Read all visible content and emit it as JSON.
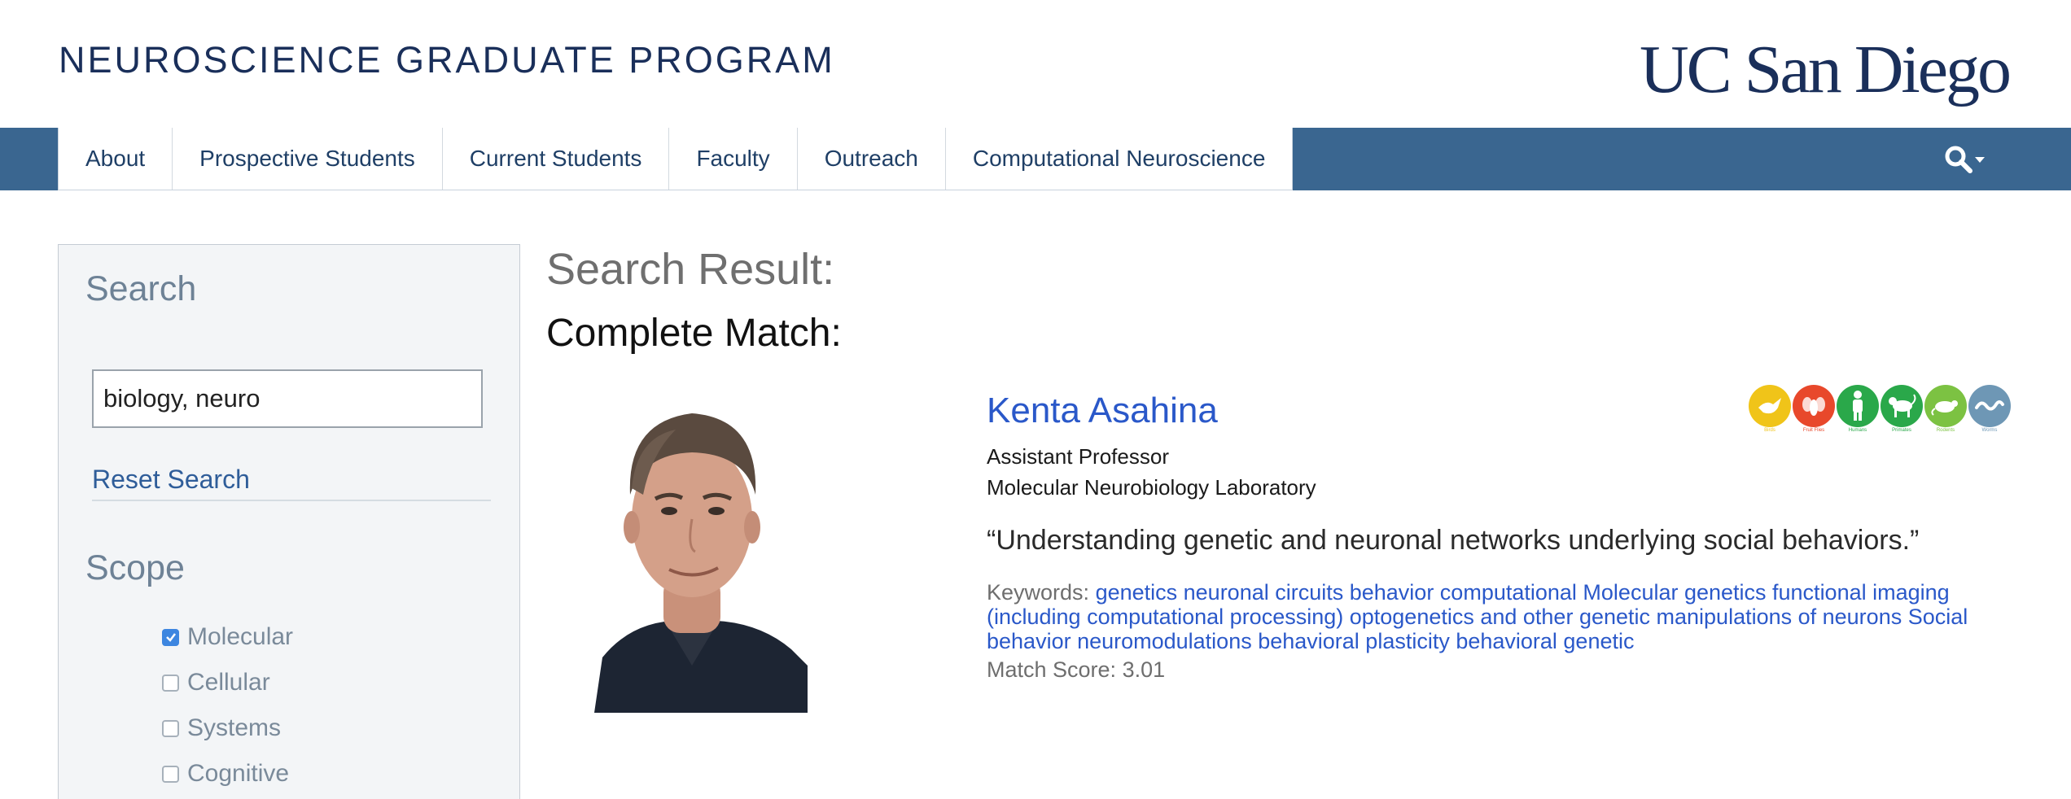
{
  "header": {
    "site_title": "NEUROSCIENCE GRADUATE PROGRAM",
    "logo_text": "UC San Diego"
  },
  "nav": {
    "items": [
      {
        "label": "About"
      },
      {
        "label": "Prospective Students"
      },
      {
        "label": "Current Students"
      },
      {
        "label": "Faculty"
      },
      {
        "label": "Outreach"
      },
      {
        "label": "Computational Neuroscience"
      }
    ],
    "search_icon": "search-icon"
  },
  "sidebar": {
    "search_heading": "Search",
    "search_value": "biology, neuro",
    "reset_label": "Reset Search",
    "scope_heading": "Scope",
    "scope_items": [
      {
        "label": "Molecular",
        "checked": true
      },
      {
        "label": "Cellular",
        "checked": false
      },
      {
        "label": "Systems",
        "checked": false
      },
      {
        "label": "Cognitive",
        "checked": false
      }
    ]
  },
  "main": {
    "result_title": "Search Result:",
    "match_title": "Complete Match:"
  },
  "result": {
    "name": "Kenta Asahina",
    "title": "Assistant Professor",
    "lab": "Molecular Neurobiology Laboratory",
    "quote": "“Understanding genetic and neuronal networks underlying social behaviors.”",
    "keywords_label": "Keywords:",
    "keywords": "genetics neuronal circuits behavior computational Molecular genetics functional imaging (including computational processing) optogenetics and other genetic manipulations of neurons Social behavior neuromodulations behavioral plasticity behavioral genetic",
    "score_label": "Match Score:",
    "score": "3.01",
    "organisms": [
      {
        "icon": "bird-icon",
        "color": "#f0c419",
        "caption": "Birds"
      },
      {
        "icon": "fly-icon",
        "color": "#e8482b",
        "caption": "Fruit Flies"
      },
      {
        "icon": "human-icon",
        "color": "#2aa84a",
        "caption": "Humans"
      },
      {
        "icon": "primate-icon",
        "color": "#2aa84a",
        "caption": "Primates"
      },
      {
        "icon": "rodent-icon",
        "color": "#7cc242",
        "caption": "Rodents"
      },
      {
        "icon": "worm-icon",
        "color": "#6e97b5",
        "caption": "Worms"
      }
    ]
  },
  "colors": {
    "navbar": "#3a6690",
    "brand_navy": "#1a2f5a",
    "link_blue": "#2a58c9",
    "checkbox_checked": "#3d86e0"
  }
}
